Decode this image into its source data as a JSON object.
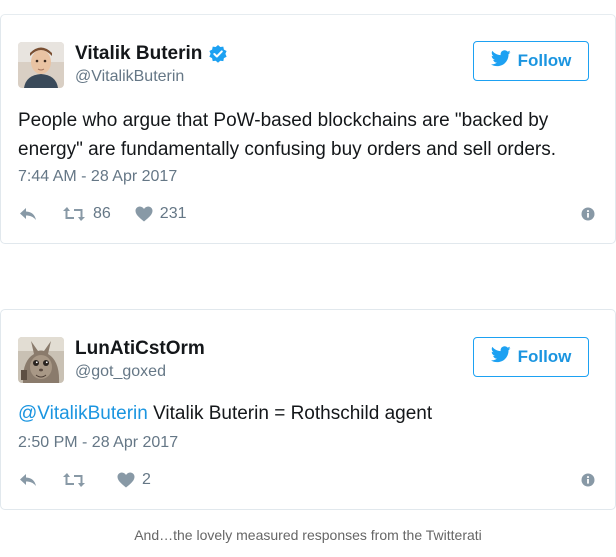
{
  "tweets": [
    {
      "display_name": "Vitalik Buterin",
      "verified": true,
      "handle": "@VitalikButerin",
      "follow_label": "Follow",
      "text": "People who argue that PoW-based blockchains are \"backed by energy\" are fundamentally confusing buy orders and sell orders.",
      "timestamp": "7:44 AM - 28 Apr 2017",
      "retweets": "86",
      "likes": "231"
    },
    {
      "display_name": "LunAtiCstOrm",
      "verified": false,
      "handle": "@got_goxed",
      "follow_label": "Follow",
      "mention": "@VitalikButerin",
      "text": " Vitalik Buterin = Rothschild agent",
      "timestamp": "2:50 PM - 28 Apr 2017",
      "retweets": "",
      "likes": "2"
    }
  ],
  "caption": "And…the lovely measured responses from the Twitterati",
  "colors": {
    "twitter_blue": "#1da1f2",
    "link_blue": "#1b95e0",
    "secondary_text": "#657786",
    "icon_gray": "#8899a6",
    "border": "#e1e8ed"
  },
  "icons": {
    "verified": "verified-badge-icon",
    "follow": "twitter-bird-icon",
    "reply": "reply-icon",
    "retweet": "retweet-icon",
    "like": "heart-icon",
    "info": "info-icon"
  }
}
